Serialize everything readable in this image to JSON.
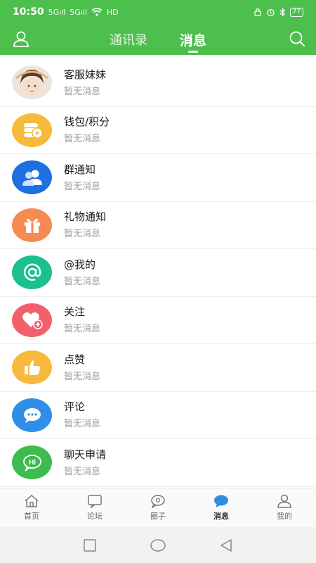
{
  "status_bar": {
    "time": "10:50",
    "signal_1": "5Gıll",
    "signal_2": "5Gıll",
    "network": "HD",
    "battery": "77"
  },
  "header": {
    "tabs": [
      {
        "label": "通讯录",
        "active": false
      },
      {
        "label": "消息",
        "active": true
      }
    ]
  },
  "messages": [
    {
      "title": "客服妹妹",
      "subtitle": "暂无消息",
      "icon": "customer-service-avatar",
      "color": "#f2e6dc"
    },
    {
      "title": "钱包/积分",
      "subtitle": "暂无消息",
      "icon": "coins-icon",
      "color": "#f7b93b"
    },
    {
      "title": "群通知",
      "subtitle": "暂无消息",
      "icon": "group-icon",
      "color": "#1e6fe0"
    },
    {
      "title": "礼物通知",
      "subtitle": "暂无消息",
      "icon": "gift-icon",
      "color": "#f58a53"
    },
    {
      "title": "@我的",
      "subtitle": "暂无消息",
      "icon": "at-icon",
      "color": "#1cbf8f"
    },
    {
      "title": "关注",
      "subtitle": "暂无消息",
      "icon": "heart-plus-icon",
      "color": "#f25f6d"
    },
    {
      "title": "点赞",
      "subtitle": "暂无消息",
      "icon": "thumbs-up-icon",
      "color": "#f7b93b"
    },
    {
      "title": "评论",
      "subtitle": "暂无消息",
      "icon": "comment-icon",
      "color": "#2f8fe8"
    },
    {
      "title": "聊天申请",
      "subtitle": "暂无消息",
      "icon": "chat-hi-icon",
      "color": "#3dbb4f"
    }
  ],
  "bottom_nav": [
    {
      "label": "首页",
      "icon": "home-icon",
      "active": false
    },
    {
      "label": "论坛",
      "icon": "forum-icon",
      "active": false
    },
    {
      "label": "圈子",
      "icon": "circle-icon",
      "active": false
    },
    {
      "label": "消息",
      "icon": "message-icon",
      "active": true
    },
    {
      "label": "我的",
      "icon": "profile-icon",
      "active": false
    }
  ],
  "colors": {
    "brand_green": "#4cbf4c",
    "active_blue": "#2e8fe0"
  }
}
